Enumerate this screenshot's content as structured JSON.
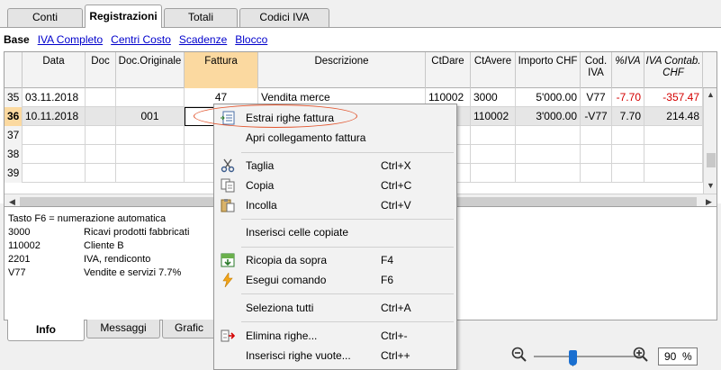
{
  "tabs": [
    "Conti",
    "Registrazioni",
    "Totali",
    "Codici IVA"
  ],
  "active_tab": "Registrazioni",
  "views": {
    "active": "Base",
    "links": [
      "IVA Completo",
      "Centri Costo",
      "Scadenze",
      "Blocco"
    ]
  },
  "table": {
    "headers": {
      "data": "Data",
      "doc": "Doc",
      "doc_originale": "Doc.Originale",
      "fattura": "Fattura",
      "descrizione": "Descrizione",
      "ctdare": "CtDare",
      "ctavere": "CtAvere",
      "importo_l1": "Importo CHF",
      "cod_iva_l1": "Cod.",
      "cod_iva_l2": "IVA",
      "perc_iva": "%IVA",
      "iva_contab_l1": "IVA Contab.",
      "iva_contab_l2": "CHF"
    },
    "rows": [
      {
        "n": "35",
        "data": "03.11.2018",
        "doc": "",
        "doc_originale": "",
        "fattura": "47",
        "descrizione": "Vendita merce",
        "ctdare": "110002",
        "ctavere": "3000",
        "importo": "5'000.00",
        "cod_iva": "V77",
        "perc_iva": "-7.70",
        "iva_contab": "-357.47"
      },
      {
        "n": "36",
        "data": "10.11.2018",
        "doc": "",
        "doc_originale": "001",
        "fattura": "",
        "descrizione": "",
        "ctdare": "",
        "ctavere": "110002",
        "importo": "3'000.00",
        "cod_iva": "-V77",
        "perc_iva": "7.70",
        "iva_contab": "214.48"
      },
      {
        "n": "37"
      },
      {
        "n": "38"
      },
      {
        "n": "39"
      }
    ]
  },
  "info": {
    "title": "Tasto F6 = numerazione automatica",
    "lines": [
      {
        "code": "3000",
        "desc": "Ricavi prodotti fabbricati"
      },
      {
        "code": "110002",
        "desc": "Cliente B"
      },
      {
        "code": "2201",
        "desc": "IVA, rendiconto"
      },
      {
        "code": "V77",
        "desc": "Vendite e servizi 7.7%"
      }
    ]
  },
  "bottom_tabs": [
    "Info",
    "Messaggi",
    "Grafic"
  ],
  "zoom": {
    "value": "90",
    "unit": "%"
  },
  "context_menu": {
    "items": {
      "estrai": {
        "label": "Estrai righe fattura",
        "key": ""
      },
      "apri": {
        "label": "Apri collegamento fattura",
        "key": ""
      },
      "taglia": {
        "label": "Taglia",
        "key": "Ctrl+X"
      },
      "copia": {
        "label": "Copia",
        "key": "Ctrl+C"
      },
      "incolla": {
        "label": "Incolla",
        "key": "Ctrl+V"
      },
      "inserisci_celle": {
        "label": "Inserisci celle copiate",
        "key": ""
      },
      "ricopia": {
        "label": "Ricopia da sopra",
        "key": "F4"
      },
      "esegui": {
        "label": "Esegui comando",
        "key": "F6"
      },
      "seleziona": {
        "label": "Seleziona tutti",
        "key": "Ctrl+A"
      },
      "elimina": {
        "label": "Elimina righe...",
        "key": "Ctrl+-"
      },
      "inserisci_righe": {
        "label": "Inserisci righe vuote...",
        "key": "Ctrl++"
      }
    }
  },
  "colors": {
    "accent_header": "#fbd9a0",
    "negative": "#d40000",
    "highlight_ring": "#e2552e",
    "link": "#0000cc"
  }
}
